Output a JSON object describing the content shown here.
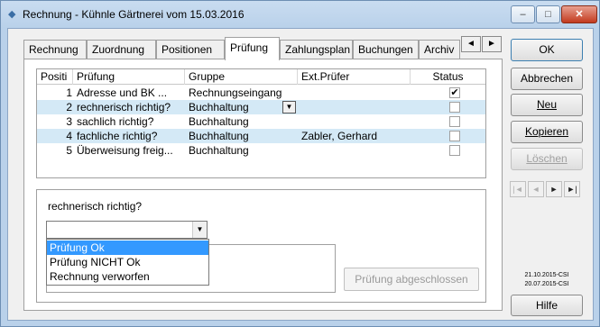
{
  "window": {
    "title": "Rechnung - Kühnle Gärtnerei vom 15.03.2016",
    "minimize_label": "‒",
    "maximize_label": "□",
    "close_label": "✕"
  },
  "tabs": [
    "Rechnung",
    "Zuordnung",
    "Positionen",
    "Prüfung",
    "Zahlungsplan",
    "Buchungen",
    "Archiv"
  ],
  "active_tab": "Prüfung",
  "tab_scroll": {
    "left": "◄",
    "right": "►"
  },
  "grid": {
    "headers": [
      "Positi",
      "Prüfung",
      "Gruppe",
      "Ext.Prüfer",
      "Status"
    ],
    "rows": [
      {
        "pos": "1",
        "pruefung": "Adresse und BK ...",
        "gruppe": "Rechnungseingang",
        "pruefer": "",
        "status": "✔"
      },
      {
        "pos": "2",
        "pruefung": "rechnerisch richtig?",
        "gruppe": "Buchhaltung",
        "pruefer": "",
        "status": ""
      },
      {
        "pos": "3",
        "pruefung": "sachlich richtig?",
        "gruppe": "Buchhaltung",
        "pruefer": "",
        "status": ""
      },
      {
        "pos": "4",
        "pruefung": "fachliche richtig?",
        "gruppe": "Buchhaltung",
        "pruefer": "Zabler, Gerhard",
        "status": ""
      },
      {
        "pos": "5",
        "pruefung": "Überweisung freig...",
        "gruppe": "Buchhaltung",
        "pruefer": "",
        "status": ""
      }
    ],
    "row_dropdown_glyph": "▼"
  },
  "detail": {
    "label": "rechnerisch richtig?",
    "combo_value": "",
    "combo_glyph": "▼",
    "options": [
      "Prüfung Ok",
      "Prüfung NICHT Ok",
      "Rechnung verworfen"
    ],
    "done_button": "Prüfung abgeschlossen"
  },
  "actions": {
    "ok": "OK",
    "cancel": "Abbrechen",
    "new": "Neu",
    "copy": "Kopieren",
    "delete": "Löschen"
  },
  "nav": {
    "first": "|◄",
    "prev": "◄",
    "next": "►",
    "last": "►|"
  },
  "stamps": [
    "21.10.2015-CSI",
    "20.07.2015-CSI"
  ],
  "help": "Hilfe"
}
